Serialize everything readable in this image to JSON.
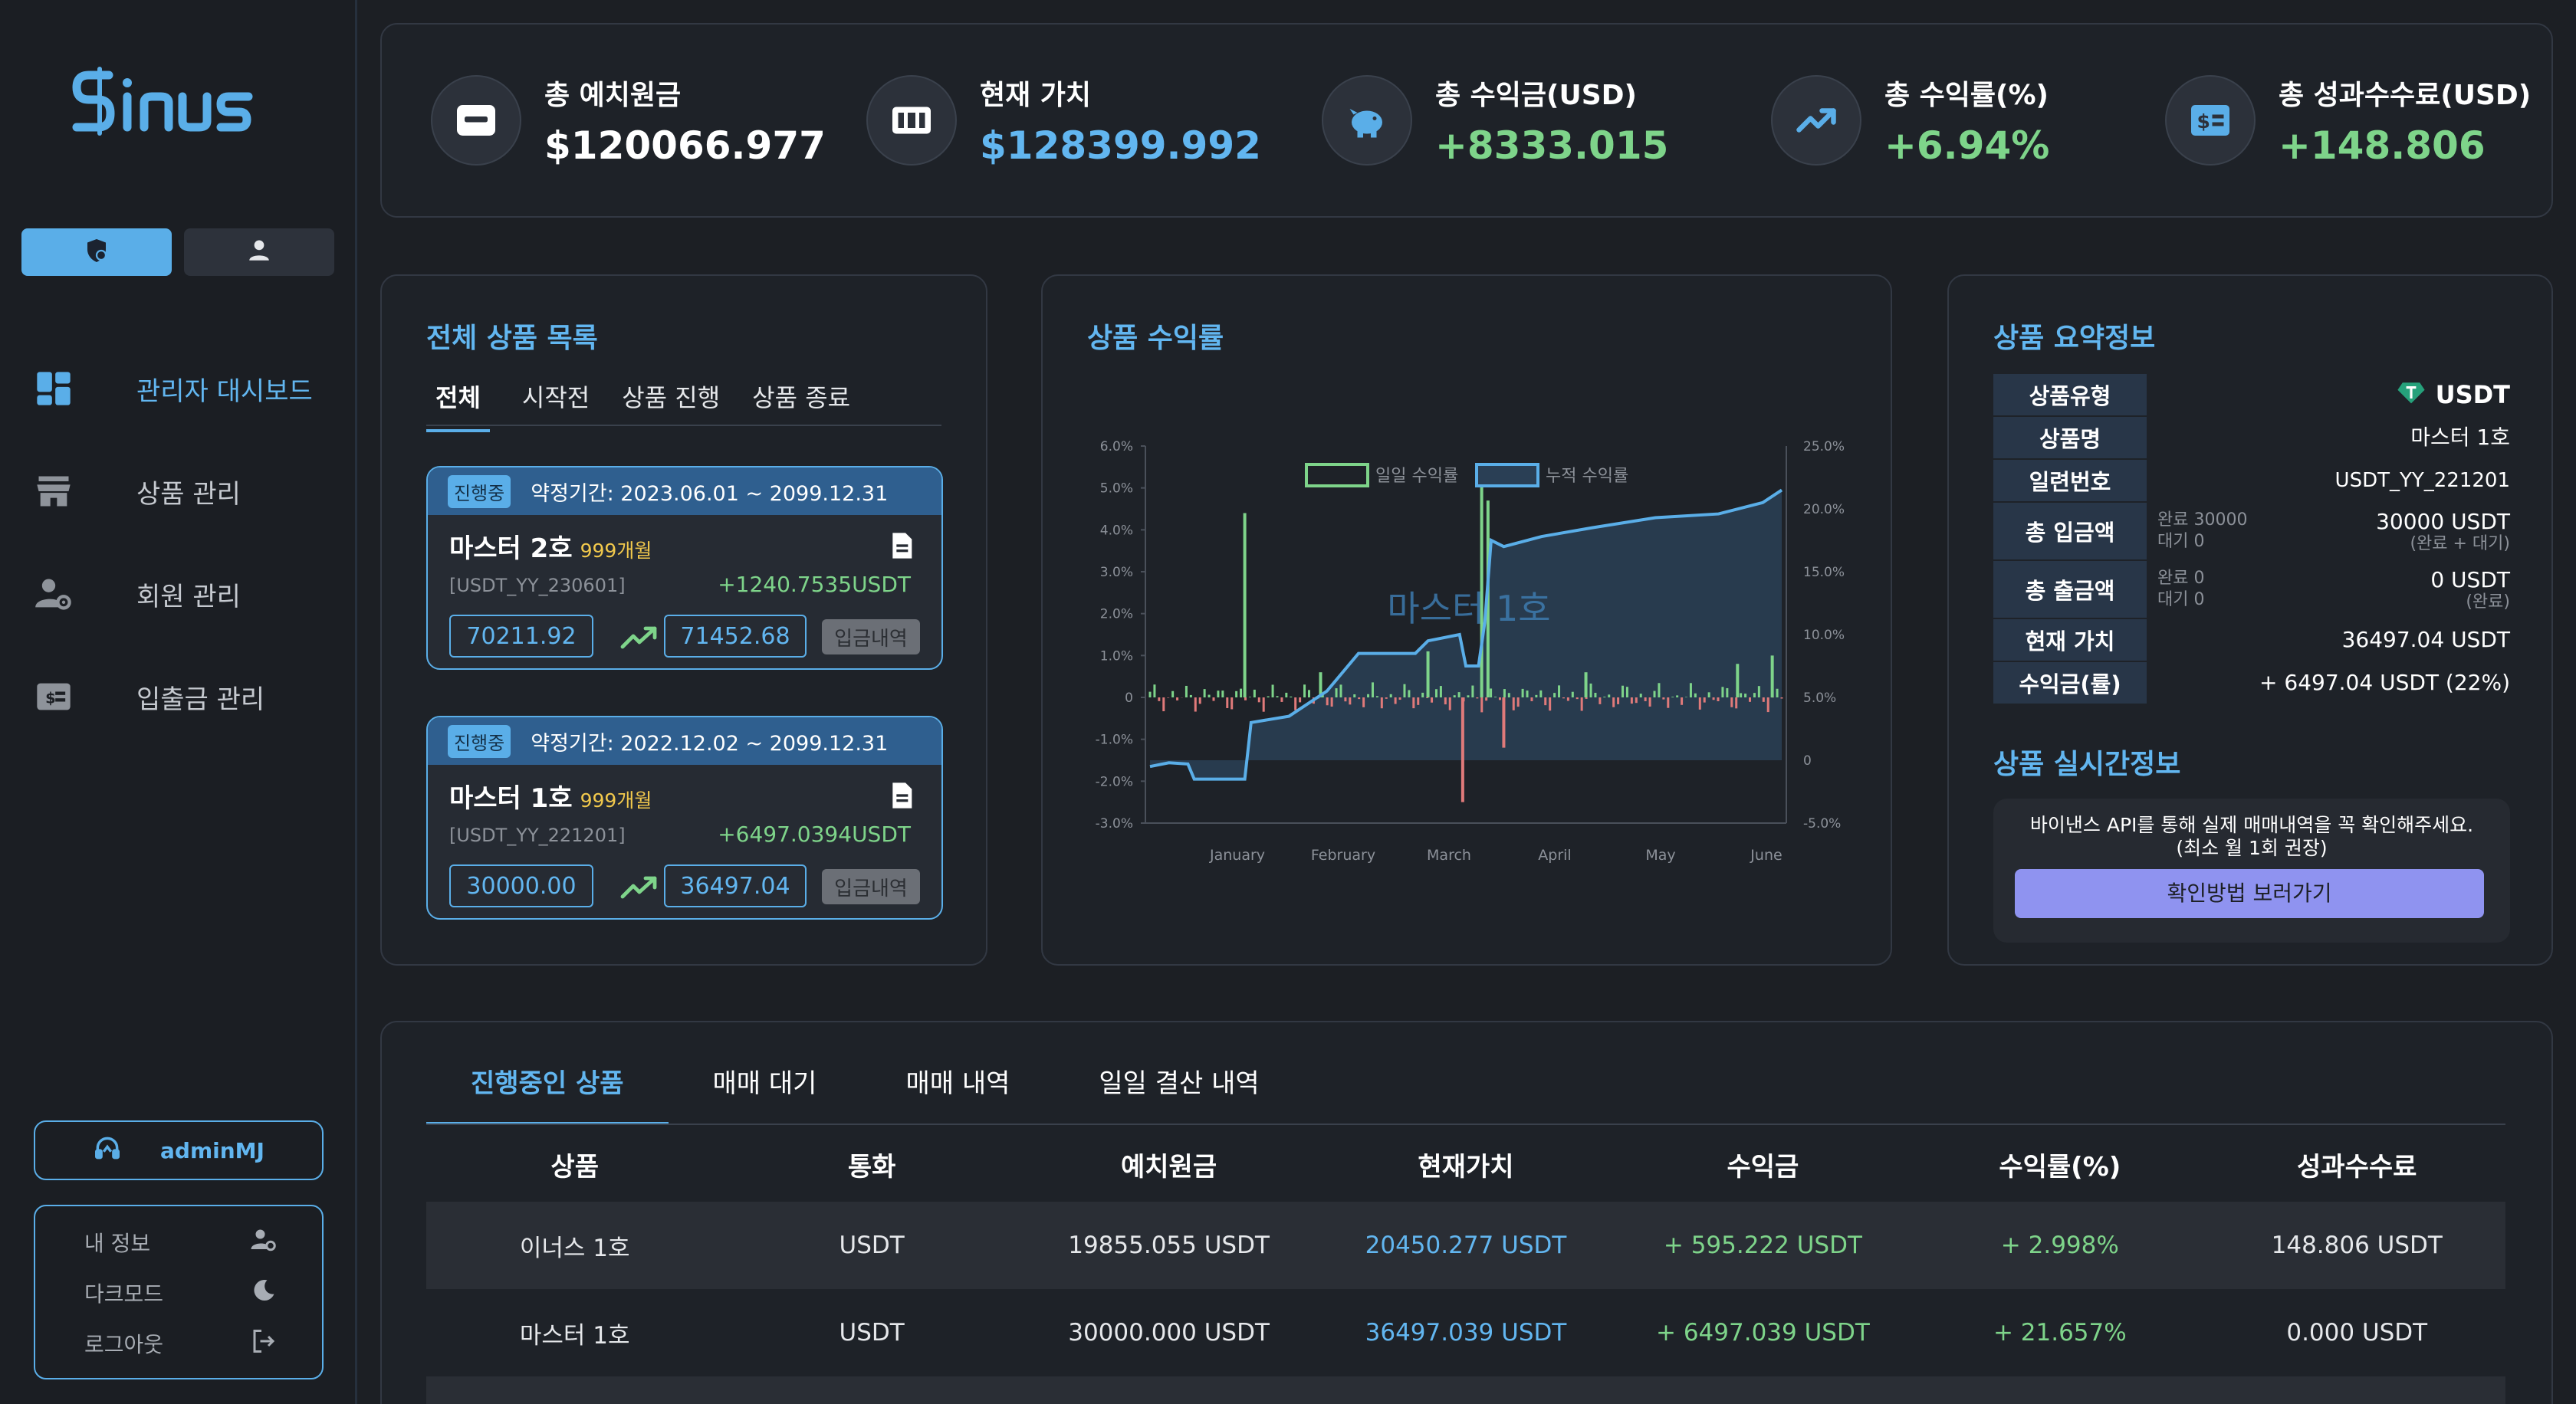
{
  "brand": {
    "name": "sinus"
  },
  "sidebar": {
    "nav": [
      {
        "label": "관리자 대시보드",
        "icon": "dashboard-icon",
        "active": true
      },
      {
        "label": "상품 관리",
        "icon": "store-icon"
      },
      {
        "label": "회원 관리",
        "icon": "user-settings-icon"
      },
      {
        "label": "입출금 관리",
        "icon": "money-icon"
      }
    ],
    "user": {
      "name": "adminMJ"
    },
    "menu": [
      {
        "label": "내 정보",
        "icon": "user-gear-icon"
      },
      {
        "label": "다크모드",
        "icon": "moon-icon"
      },
      {
        "label": "로그아웃",
        "icon": "logout-icon"
      }
    ]
  },
  "stats": [
    {
      "title": "총 예치원금",
      "value": "$120066.977",
      "color": "white",
      "icon": "wallet-icon"
    },
    {
      "title": "현재 가치",
      "value": "$128399.992",
      "color": "blue",
      "icon": "counter-icon"
    },
    {
      "title": "총 수익금(USD)",
      "value": "+8333.015",
      "color": "green",
      "icon": "piggy-bank-icon"
    },
    {
      "title": "총 수익률(%)",
      "value": "+6.94%",
      "color": "green",
      "icon": "trending-up-icon"
    },
    {
      "title": "총 성과수수료(USD)",
      "value": "+148.806",
      "color": "green",
      "icon": "fee-icon"
    }
  ],
  "product_list": {
    "title": "전체 상품 목록",
    "tabs": [
      "전체",
      "시작전",
      "상품 진행",
      "상품 종료"
    ],
    "items": [
      {
        "status": "진행중",
        "period": "약정기간: 2023.06.01 ~ 2099.12.31",
        "name": "마스터 2호",
        "duration": "999개월",
        "code": "[USDT_YY_230601]",
        "profit": "+1240.7535USDT",
        "principal": "70211.92",
        "current": "71452.68",
        "history_label": "입금내역"
      },
      {
        "status": "진행중",
        "period": "약정기간: 2022.12.02 ~ 2099.12.31",
        "name": "마스터 1호",
        "duration": "999개월",
        "code": "[USDT_YY_221201]",
        "profit": "+6497.0394USDT",
        "principal": "30000.00",
        "current": "36497.04",
        "history_label": "입금내역"
      }
    ]
  },
  "chart_title": "상품 수익률",
  "chart_data": {
    "type": "bar",
    "overlay_label": "마스터 1호",
    "legend": [
      "일일 수익률",
      "누적 수익률"
    ],
    "x_labels": [
      "January",
      "February",
      "March",
      "April",
      "May",
      "June"
    ],
    "y_left_ticks": [
      "6.0%",
      "5.0%",
      "4.0%",
      "3.0%",
      "2.0%",
      "1.0%",
      "0",
      "-1.0%",
      "-2.0%",
      "-3.0%"
    ],
    "y_right_ticks": [
      "25.0%",
      "20.0%",
      "15.0%",
      "10.0%",
      "5.0%",
      "0",
      "-5.0%"
    ],
    "ylim_left": [
      -3,
      6
    ],
    "ylim_right": [
      -5,
      25
    ],
    "daily_spikes": [
      {
        "x": 0.15,
        "y": 4.4
      },
      {
        "x": 0.27,
        "y": 0.6
      },
      {
        "x": 0.44,
        "y": 1.1
      },
      {
        "x": 0.495,
        "y": -2.5
      },
      {
        "x": 0.525,
        "y": 5.2
      },
      {
        "x": 0.535,
        "y": 4.7
      },
      {
        "x": 0.56,
        "y": -1.2
      },
      {
        "x": 0.69,
        "y": 0.6
      },
      {
        "x": 0.93,
        "y": 0.8
      },
      {
        "x": 0.985,
        "y": 1.0
      }
    ],
    "cumulative": [
      {
        "x": 0.0,
        "y": -0.5
      },
      {
        "x": 0.03,
        "y": -0.2
      },
      {
        "x": 0.06,
        "y": -0.3
      },
      {
        "x": 0.07,
        "y": -1.5
      },
      {
        "x": 0.15,
        "y": -1.5
      },
      {
        "x": 0.16,
        "y": 3.0
      },
      {
        "x": 0.22,
        "y": 3.5
      },
      {
        "x": 0.28,
        "y": 5.5
      },
      {
        "x": 0.33,
        "y": 8.5
      },
      {
        "x": 0.42,
        "y": 8.5
      },
      {
        "x": 0.44,
        "y": 9.5
      },
      {
        "x": 0.49,
        "y": 10.0
      },
      {
        "x": 0.5,
        "y": 7.5
      },
      {
        "x": 0.52,
        "y": 7.5
      },
      {
        "x": 0.53,
        "y": 11.0
      },
      {
        "x": 0.54,
        "y": 17.5
      },
      {
        "x": 0.56,
        "y": 17.0
      },
      {
        "x": 0.62,
        "y": 17.8
      },
      {
        "x": 0.7,
        "y": 18.5
      },
      {
        "x": 0.8,
        "y": 19.3
      },
      {
        "x": 0.9,
        "y": 19.6
      },
      {
        "x": 0.97,
        "y": 20.5
      },
      {
        "x": 1.0,
        "y": 21.5
      }
    ],
    "colors": {
      "positive": "#7ed48a",
      "negative": "#e07a7a",
      "cumulative": "#5aaee8"
    }
  },
  "summary": {
    "title": "상품 요약정보",
    "rows": [
      {
        "key": "상품유형",
        "value": "USDT",
        "icon": "tether-icon"
      },
      {
        "key": "상품명",
        "value": "마스터 1호",
        "color": "blue"
      },
      {
        "key": "일련번호",
        "value": "USDT_YY_221201"
      },
      {
        "key": "총 입금액",
        "sub1": "완료 30000",
        "sub2": "대기 0",
        "value": "30000 USDT",
        "note": "(완료 + 대기)"
      },
      {
        "key": "총 출금액",
        "sub1": "완료 0",
        "sub2": "대기 0",
        "value": "0 USDT",
        "note": "(완료)"
      },
      {
        "key": "현재 가치",
        "value": "36497.04 USDT"
      },
      {
        "key": "수익금(률)",
        "value": "+ 6497.04 USDT (22%)",
        "color": "green"
      }
    ],
    "realtime_title": "상품 실시간정보",
    "realtime_text1": "바이낸스 API를 통해 실제 매매내역을 꼭 확인해주세요.",
    "realtime_text2": "(최소 월 1회 권장)",
    "realtime_button": "확인방법 보러가기"
  },
  "bottom": {
    "tabs": [
      "진행중인 상품",
      "매매 대기",
      "매매 내역",
      "일일 결산 내역"
    ],
    "columns": [
      "상품",
      "통화",
      "예치원금",
      "현재가치",
      "수익금",
      "수익률(%)",
      "성과수수료"
    ],
    "rows": [
      [
        "이너스 1호",
        "USDT",
        "19855.055 USDT",
        "20450.277 USDT",
        "+ 595.222 USDT",
        "+ 2.998%",
        "148.806 USDT"
      ],
      [
        "마스터 1호",
        "USDT",
        "30000.000 USDT",
        "36497.039 USDT",
        "+ 6497.039 USDT",
        "+ 21.657%",
        "0.000 USDT"
      ]
    ]
  }
}
